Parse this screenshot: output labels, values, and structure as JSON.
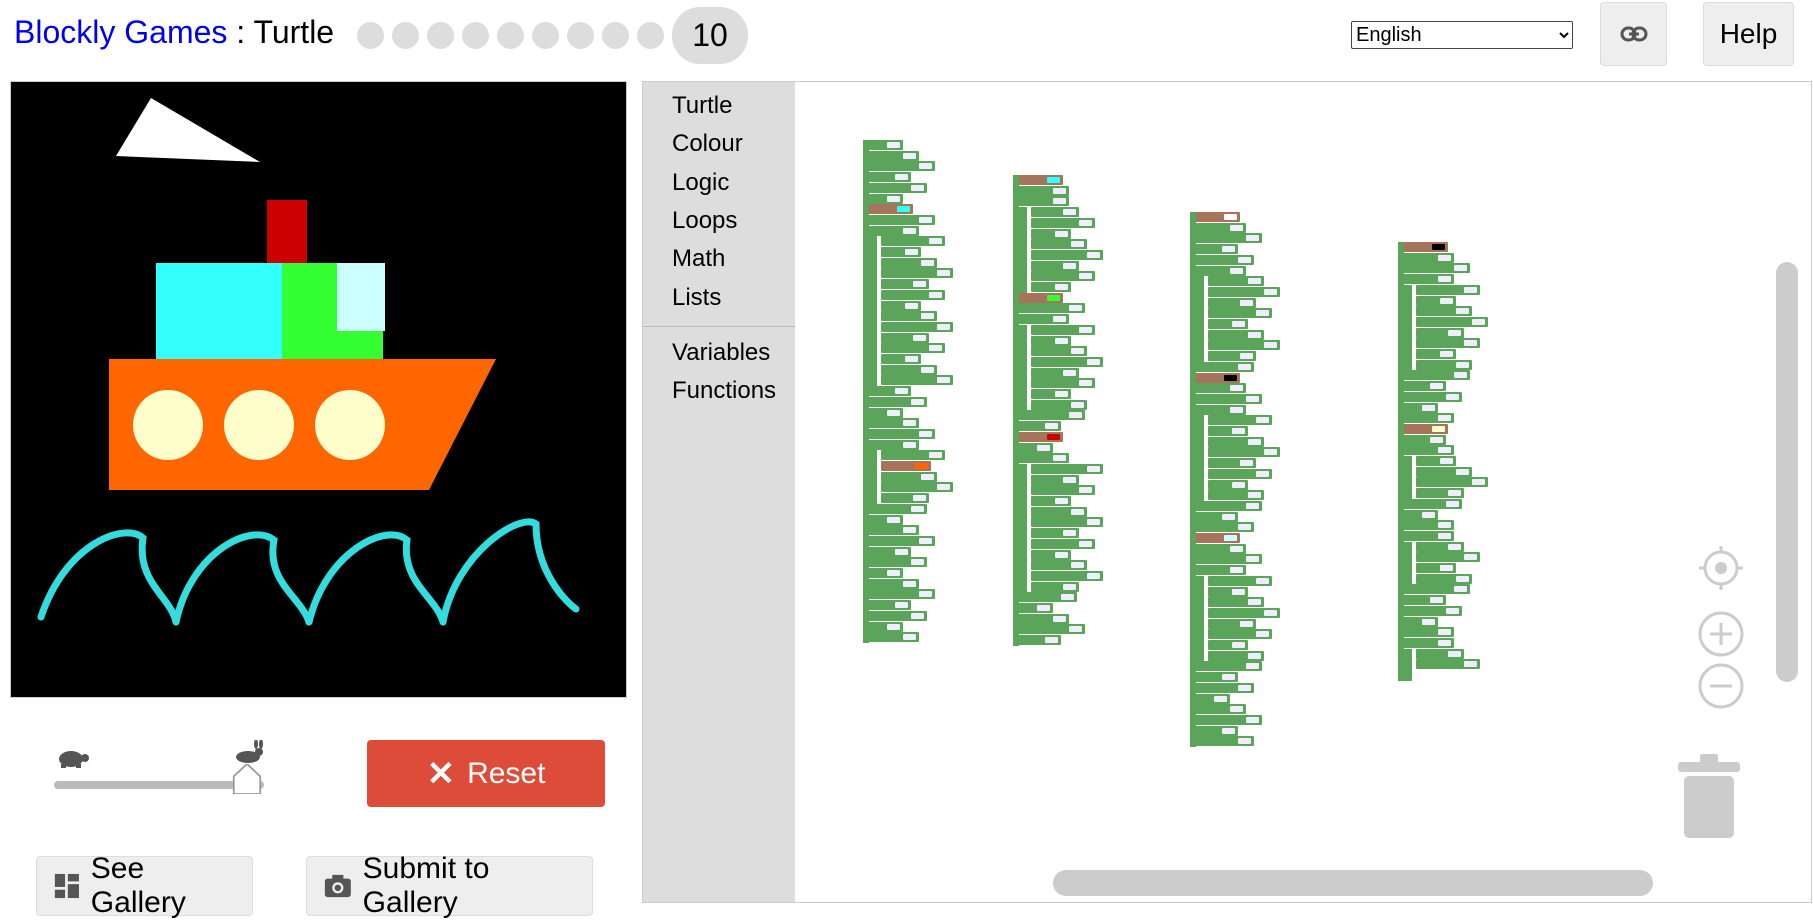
{
  "header": {
    "app_name": "Blockly Games",
    "separator": ":",
    "game_name": "Turtle",
    "levels": [
      1,
      2,
      3,
      4,
      5,
      6,
      7,
      8,
      9
    ],
    "current_level": "10",
    "language": "English",
    "help_label": "Help"
  },
  "controls": {
    "reset_label": "Reset",
    "see_gallery_label": "See Gallery",
    "submit_gallery_label": "Submit to Gallery",
    "speed": 0.95
  },
  "toolbox": {
    "items": [
      "Turtle",
      "Colour",
      "Logic",
      "Loops",
      "Math",
      "Lists"
    ],
    "items2": [
      "Variables",
      "Functions"
    ]
  },
  "drawing": {
    "background": "#000000",
    "sail_color": "#ffffff",
    "chimney_color": "#cc0000",
    "cabin_left_color": "#33ffff",
    "cabin_right_color": "#33ff33",
    "window_color": "#ccffff",
    "hull_color": "#ff6600",
    "porthole_color": "#ffffcc",
    "wave_color": "#33dddd"
  },
  "colors": {
    "block_green": "#5ba55b",
    "block_brown": "#a5745b",
    "reset_red": "#dd4b39"
  },
  "workspace": {
    "stacks": [
      {
        "colour_swatches": [
          "#33ffff",
          "#ff6600"
        ]
      },
      {
        "colour_swatches": [
          "#33ffff",
          "#33ff33",
          "#cc0000"
        ]
      },
      {
        "colour_swatches": [
          "#ffffff",
          "#000000",
          "#ccffff"
        ]
      },
      {
        "colour_swatches": [
          "#000000",
          "#ffffcc"
        ]
      }
    ]
  }
}
